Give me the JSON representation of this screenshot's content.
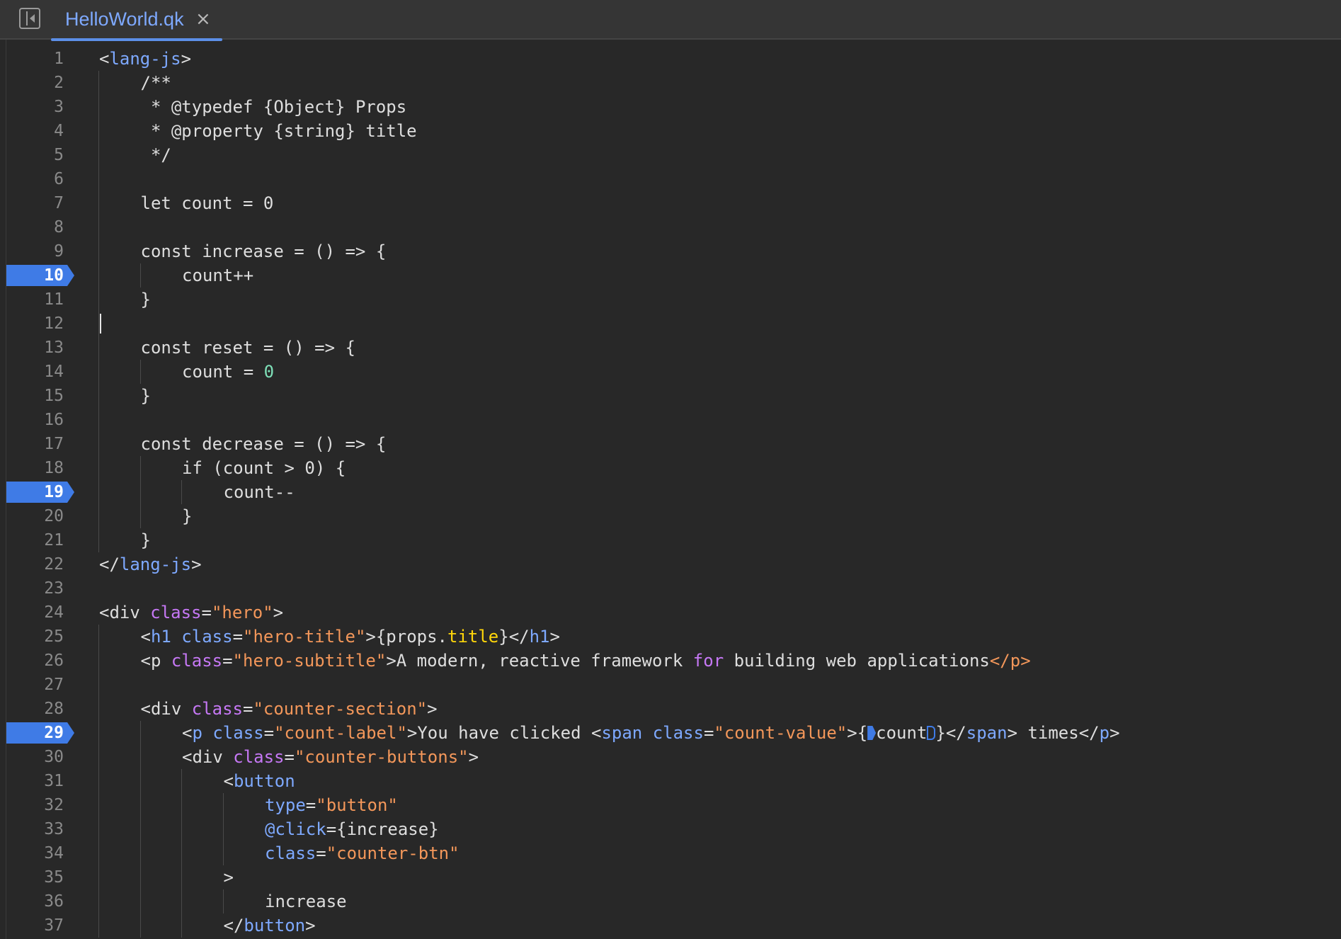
{
  "tabbar": {
    "sidebar_toggle_icon": "sidebar-collapse-icon",
    "tabs": [
      {
        "label": "HelloWorld.qk",
        "close_icon": "×",
        "active": true
      }
    ]
  },
  "editor": {
    "colors": {
      "background": "#282828",
      "breakpoint": "#3f7be6",
      "tag": "#7ea9ff",
      "attribute": "#c678f5",
      "string": "#f3975a",
      "number": "#7ee0b8",
      "property": "#ffd60a"
    },
    "breakpoints": [
      10,
      19,
      29
    ],
    "cursor_line": 12,
    "lines": [
      {
        "n": "1",
        "indent": 0,
        "tokens": [
          [
            "<",
            "t-plain"
          ],
          [
            "lang-js",
            "t-tag"
          ],
          [
            ">",
            "t-plain"
          ]
        ]
      },
      {
        "n": "2",
        "indent": 1,
        "tokens": [
          [
            "/**",
            "t-plain"
          ]
        ]
      },
      {
        "n": "3",
        "indent": 1,
        "tokens": [
          [
            " * @typedef {",
            "t-plain"
          ],
          [
            "Object",
            "t-plain"
          ],
          [
            "} Props",
            "t-plain"
          ]
        ]
      },
      {
        "n": "4",
        "indent": 1,
        "tokens": [
          [
            " * @property {string} title",
            "t-plain"
          ]
        ]
      },
      {
        "n": "5",
        "indent": 1,
        "tokens": [
          [
            " */",
            "t-plain"
          ]
        ]
      },
      {
        "n": "6",
        "indent": 0,
        "tokens": []
      },
      {
        "n": "7",
        "indent": 1,
        "tokens": [
          [
            "let count = ",
            "t-plain"
          ],
          [
            "0",
            "t-plain"
          ]
        ]
      },
      {
        "n": "8",
        "indent": 0,
        "tokens": []
      },
      {
        "n": "9",
        "indent": 1,
        "tokens": [
          [
            "const increase = () => {",
            "t-plain"
          ]
        ]
      },
      {
        "n": "10",
        "indent": 2,
        "tokens": [
          [
            "count++",
            "t-plain"
          ]
        ]
      },
      {
        "n": "11",
        "indent": 1,
        "tokens": [
          [
            "}",
            "t-plain"
          ]
        ]
      },
      {
        "n": "12",
        "indent": 0,
        "tokens": []
      },
      {
        "n": "13",
        "indent": 1,
        "tokens": [
          [
            "const reset = () => {",
            "t-plain"
          ]
        ]
      },
      {
        "n": "14",
        "indent": 2,
        "tokens": [
          [
            "count = ",
            "t-plain"
          ],
          [
            "0",
            "t-num"
          ]
        ]
      },
      {
        "n": "15",
        "indent": 1,
        "tokens": [
          [
            "}",
            "t-plain"
          ]
        ]
      },
      {
        "n": "16",
        "indent": 0,
        "tokens": []
      },
      {
        "n": "17",
        "indent": 1,
        "tokens": [
          [
            "const decrease = () => {",
            "t-plain"
          ]
        ]
      },
      {
        "n": "18",
        "indent": 2,
        "tokens": [
          [
            "if (count > ",
            "t-plain"
          ],
          [
            "0",
            "t-plain"
          ],
          [
            ") {",
            "t-plain"
          ]
        ]
      },
      {
        "n": "19",
        "indent": 3,
        "tokens": [
          [
            "count--",
            "t-plain"
          ]
        ]
      },
      {
        "n": "20",
        "indent": 2,
        "tokens": [
          [
            "}",
            "t-plain"
          ]
        ]
      },
      {
        "n": "21",
        "indent": 1,
        "tokens": [
          [
            "}",
            "t-plain"
          ]
        ]
      },
      {
        "n": "22",
        "indent": 0,
        "tokens": [
          [
            "</",
            "t-plain"
          ],
          [
            "lang-js",
            "t-tag"
          ],
          [
            ">",
            "t-plain"
          ]
        ]
      },
      {
        "n": "23",
        "indent": 0,
        "tokens": []
      },
      {
        "n": "24",
        "indent": 0,
        "tokens": [
          [
            "<div ",
            "t-plain"
          ],
          [
            "class",
            "t-attr"
          ],
          [
            "=",
            "t-plain"
          ],
          [
            "\"hero\"",
            "t-str"
          ],
          [
            ">",
            "t-plain"
          ]
        ]
      },
      {
        "n": "25",
        "indent": 1,
        "tokens": [
          [
            "<",
            "t-plain"
          ],
          [
            "h1",
            "t-tag"
          ],
          [
            " ",
            "t-plain"
          ],
          [
            "class",
            "t-tag"
          ],
          [
            "=",
            "t-plain"
          ],
          [
            "\"hero-title\"",
            "t-str"
          ],
          [
            ">{props.",
            "t-plain"
          ],
          [
            "title",
            "t-prop"
          ],
          [
            "}</",
            "t-plain"
          ],
          [
            "h1",
            "t-tag"
          ],
          [
            ">",
            "t-plain"
          ]
        ]
      },
      {
        "n": "26",
        "indent": 1,
        "tokens": [
          [
            "<p ",
            "t-plain"
          ],
          [
            "class",
            "t-attr"
          ],
          [
            "=",
            "t-plain"
          ],
          [
            "\"hero-subtitle\"",
            "t-str"
          ],
          [
            ">A modern, reactive framework ",
            "t-plain"
          ],
          [
            "for",
            "t-kw"
          ],
          [
            " building web applications",
            "t-plain"
          ],
          [
            "</p>",
            "t-red"
          ]
        ]
      },
      {
        "n": "27",
        "indent": 0,
        "tokens": []
      },
      {
        "n": "28",
        "indent": 1,
        "tokens": [
          [
            "<div ",
            "t-plain"
          ],
          [
            "class",
            "t-attr"
          ],
          [
            "=",
            "t-plain"
          ],
          [
            "\"counter-section\"",
            "t-str"
          ],
          [
            ">",
            "t-plain"
          ]
        ]
      },
      {
        "n": "29",
        "indent": 2,
        "tokens": [
          [
            "<",
            "t-plain"
          ],
          [
            "p",
            "t-tag"
          ],
          [
            " ",
            "t-plain"
          ],
          [
            "class",
            "t-tag"
          ],
          [
            "=",
            "t-plain"
          ],
          [
            "\"count-label\"",
            "t-str"
          ],
          [
            ">You have clicked <",
            "t-plain"
          ],
          [
            "span",
            "t-tag"
          ],
          [
            " ",
            "t-plain"
          ],
          [
            "class",
            "t-tag"
          ],
          [
            "=",
            "t-plain"
          ],
          [
            "\"count-value\"",
            "t-str"
          ],
          [
            ">{",
            "t-plain"
          ],
          [
            "@@START@@",
            "marker"
          ],
          [
            "count",
            "t-plain"
          ],
          [
            "@@END@@",
            "marker"
          ],
          [
            "}</",
            "t-plain"
          ],
          [
            "span",
            "t-tag"
          ],
          [
            "> times</",
            "t-plain"
          ],
          [
            "p",
            "t-tag"
          ],
          [
            ">",
            "t-plain"
          ]
        ]
      },
      {
        "n": "30",
        "indent": 2,
        "tokens": [
          [
            "<div ",
            "t-plain"
          ],
          [
            "class",
            "t-attr"
          ],
          [
            "=",
            "t-plain"
          ],
          [
            "\"counter-buttons\"",
            "t-str"
          ],
          [
            ">",
            "t-plain"
          ]
        ]
      },
      {
        "n": "31",
        "indent": 3,
        "tokens": [
          [
            "<",
            "t-plain"
          ],
          [
            "button",
            "t-tag"
          ]
        ]
      },
      {
        "n": "32",
        "indent": 4,
        "tokens": [
          [
            "type",
            "t-tag"
          ],
          [
            "=",
            "t-plain"
          ],
          [
            "\"button\"",
            "t-str"
          ]
        ]
      },
      {
        "n": "33",
        "indent": 4,
        "tokens": [
          [
            "@click",
            "t-tag"
          ],
          [
            "={increase}",
            "t-plain"
          ]
        ]
      },
      {
        "n": "34",
        "indent": 4,
        "tokens": [
          [
            "class",
            "t-tag"
          ],
          [
            "=",
            "t-plain"
          ],
          [
            "\"counter-btn\"",
            "t-str"
          ]
        ]
      },
      {
        "n": "35",
        "indent": 3,
        "tokens": [
          [
            ">",
            "t-plain"
          ]
        ]
      },
      {
        "n": "36",
        "indent": 4,
        "tokens": [
          [
            "increase",
            "t-plain"
          ]
        ]
      },
      {
        "n": "37",
        "indent": 3,
        "tokens": [
          [
            "</",
            "t-plain"
          ],
          [
            "button",
            "t-tag"
          ],
          [
            ">",
            "t-plain"
          ]
        ]
      }
    ]
  }
}
